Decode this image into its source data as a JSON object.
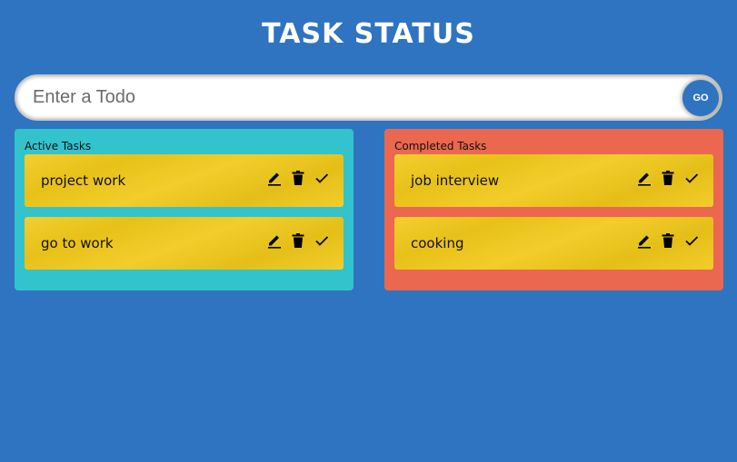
{
  "header": {
    "title": "TASK STATUS"
  },
  "todo_input": {
    "placeholder": "Enter a Todo",
    "value": "",
    "submit_label": "GO"
  },
  "active_panel": {
    "heading": "Active Tasks",
    "color": "#32c3cd",
    "tasks": [
      {
        "text": "project work"
      },
      {
        "text": "go to work"
      }
    ]
  },
  "completed_panel": {
    "heading": "Completed Tasks",
    "color": "#eb6750",
    "tasks": [
      {
        "text": "job interview"
      },
      {
        "text": "cooking"
      }
    ]
  },
  "task_actions": [
    "edit-icon",
    "delete-icon",
    "check-icon"
  ],
  "colors": {
    "background": "#2f74c0",
    "card": "#f1c919"
  }
}
